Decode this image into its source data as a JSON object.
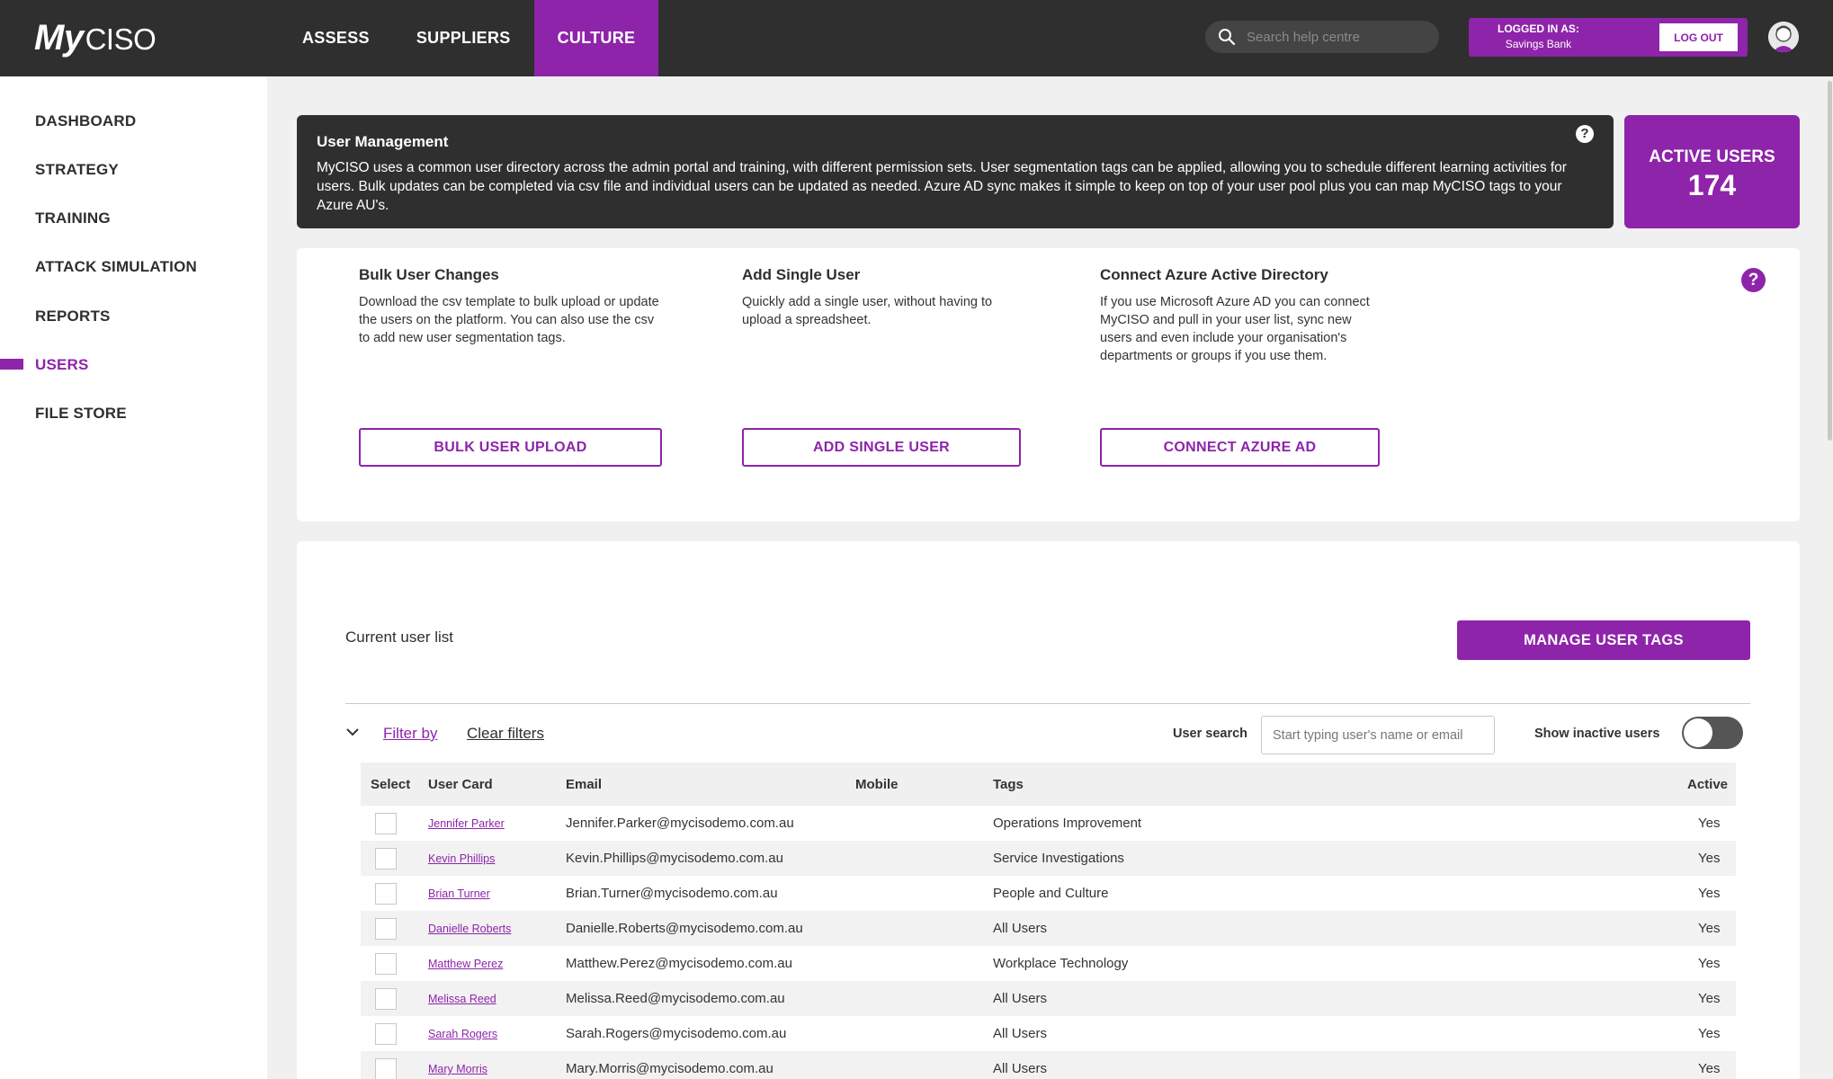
{
  "brand": {
    "logo_my": "My",
    "logo_ciso": "CISO",
    "accent": "#8e24aa",
    "dark": "#2f2f2f"
  },
  "nav": {
    "items": [
      {
        "label": "ASSESS",
        "active": false
      },
      {
        "label": "SUPPLIERS",
        "active": false
      },
      {
        "label": "CULTURE",
        "active": true
      }
    ]
  },
  "search": {
    "placeholder": "Search help centre"
  },
  "login": {
    "label": "LOGGED IN AS:",
    "org": "Savings Bank",
    "logout": "LOG OUT"
  },
  "sidebar": {
    "items": [
      {
        "label": "DASHBOARD",
        "active": false
      },
      {
        "label": "STRATEGY",
        "active": false
      },
      {
        "label": "TRAINING",
        "active": false
      },
      {
        "label": "ATTACK SIMULATION",
        "active": false
      },
      {
        "label": "REPORTS",
        "active": false
      },
      {
        "label": "USERS",
        "active": true
      },
      {
        "label": "FILE STORE",
        "active": false
      }
    ]
  },
  "info": {
    "title": "User Management",
    "body": "MyCISO uses a common user directory across the admin portal and training, with different permission sets. User segmentation tags can be applied, allowing you to schedule different learning activities for users. Bulk updates can be completed via csv file and individual users can be updated as needed. Azure AD sync makes it simple to keep on top of your user pool plus you can map MyCISO tags to your Azure AU's.",
    "help": "?"
  },
  "active_users": {
    "label": "ACTIVE USERS",
    "value": "174"
  },
  "actions": {
    "help": "?",
    "bulk": {
      "title": "Bulk User Changes",
      "desc": "Download the csv template to bulk upload or update the users on the platform. You can also use the csv to add new user segmentation tags.",
      "button": "BULK USER UPLOAD"
    },
    "single": {
      "title": "Add Single User",
      "desc": "Quickly add a single user, without having to upload a spreadsheet.",
      "button": "ADD SINGLE USER"
    },
    "azure": {
      "title": "Connect Azure Active Directory",
      "desc": "If you use Microsoft Azure AD you can connect MyCISO and pull in your user list, sync new users and even include your organisation's departments or groups if you use them.",
      "button": "CONNECT AZURE AD"
    }
  },
  "list": {
    "title": "Current user list",
    "manage_tags": "MANAGE USER TAGS",
    "filter_by": "Filter by",
    "clear_filters": "Clear filters",
    "user_search_label": "User search",
    "user_search_placeholder": "Start typing user's name or email",
    "show_inactive_label": "Show inactive users",
    "show_inactive": false,
    "columns": {
      "select": "Select",
      "user_card": "User Card",
      "email": "Email",
      "mobile": "Mobile",
      "tags": "Tags",
      "active": "Active"
    },
    "rows": [
      {
        "name": "Jennifer Parker",
        "email": "Jennifer.Parker@mycisodemo.com.au",
        "mobile": "",
        "tags": "Operations Improvement",
        "active": "Yes"
      },
      {
        "name": "Kevin Phillips",
        "email": "Kevin.Phillips@mycisodemo.com.au",
        "mobile": "",
        "tags": "Service Investigations",
        "active": "Yes"
      },
      {
        "name": "Brian Turner",
        "email": "Brian.Turner@mycisodemo.com.au",
        "mobile": "",
        "tags": "People and Culture",
        "active": "Yes"
      },
      {
        "name": "Danielle Roberts",
        "email": "Danielle.Roberts@mycisodemo.com.au",
        "mobile": "",
        "tags": "All Users",
        "active": "Yes"
      },
      {
        "name": "Matthew Perez",
        "email": "Matthew.Perez@mycisodemo.com.au",
        "mobile": "",
        "tags": "Workplace Technology",
        "active": "Yes"
      },
      {
        "name": "Melissa Reed",
        "email": "Melissa.Reed@mycisodemo.com.au",
        "mobile": "",
        "tags": "All Users",
        "active": "Yes"
      },
      {
        "name": "Sarah Rogers",
        "email": "Sarah.Rogers@mycisodemo.com.au",
        "mobile": "",
        "tags": "All Users",
        "active": "Yes"
      },
      {
        "name": "Mary Morris",
        "email": "Mary.Morris@mycisodemo.com.au",
        "mobile": "",
        "tags": "All Users",
        "active": "Yes"
      }
    ]
  }
}
